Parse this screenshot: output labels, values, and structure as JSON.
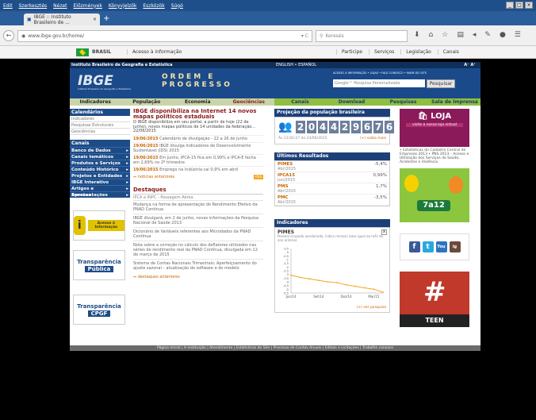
{
  "browser": {
    "menu": [
      "Edit",
      "Szerkesztés",
      "Nézet",
      "Előzmények",
      "Könyvjelzők",
      "Eszközök",
      "Súgó"
    ],
    "tab_title": "IBGE :: Instituto Brasileiro de ...",
    "url": "www.ibge.gov.br/home/",
    "search_placeholder": "Keresés",
    "win_buttons": [
      "_",
      "□",
      "×"
    ]
  },
  "govbar": {
    "country": "BRASIL",
    "access": "Acesso à informação",
    "links": [
      "Participe",
      "Serviços",
      "Legislação",
      "Canais"
    ]
  },
  "header": {
    "institute": "Instituto Brasileiro de Geografia e Estatística",
    "lang": "ENGLISH • ESPAÑOL",
    "aa": "A⁻  A⁺",
    "logo": "IBGE",
    "logo_sub": "Instituto Brasileiro de Geografia e Estatística",
    "motto": "ORDEM E PROGRESSO",
    "quicklinks": "ACESSO À INFORMAÇÃO • LOJAS • FALE CONOSCO • MAPA DO SITE",
    "search_placeholder": "Google™ Pesquisa Personalizada",
    "search_button": "Pesquisar"
  },
  "menu1": [
    "Indicadores",
    "População",
    "Economia",
    "Geociências"
  ],
  "menu2": [
    "Canais",
    "Download",
    "Pesquisas",
    "Sala de Imprensa"
  ],
  "calendar": {
    "title": "Calendários",
    "items": [
      "Indicadores",
      "Pesquisas Estruturais",
      "Geociências"
    ]
  },
  "canais": {
    "title": "Canais",
    "items": [
      "Banco de Dados",
      "Canais temáticos",
      "Produtos e Serviços",
      "Conteúdo Histórico",
      "Projetos e Entidades",
      "IBGE Interativo",
      "Artigos e Apresentações",
      "Eventos"
    ]
  },
  "side": {
    "acesso": "Acesso à Informação",
    "transp1_a": "Transparência",
    "transp1_b": "Pública",
    "transp2_a": "Transparência",
    "transp2_b": "CPGF"
  },
  "news": {
    "headline": "IBGE disponibiliza na Internet 14 novos mapas políticos estaduais",
    "headline_text": "O IBGE disponibiliza em seu portal, a partir de hoje (22 de junho), novos mapas políticos de 14 unidades da federação... 22/06/2015",
    "items": [
      {
        "date": "19/06/2015",
        "text": "Calendário de divulgação - 22 a 26 de junho"
      },
      {
        "date": "19/06/2015",
        "text": "IBGE divulga Indicadores de Desenvolvimento Sustentável (IDS) 2015"
      },
      {
        "date": "19/06/2015",
        "text": "Em junho, IPCA-15 fica em 0,99% e IPCA-E fecha em 2,69% no 2º trimestre"
      },
      {
        "date": "19/06/2015",
        "text": "Emprego na Indústria cai 0,9% em abril"
      }
    ],
    "more": "notícias anteriores",
    "rss": "RSS"
  },
  "destaques": {
    "title": "Destaques",
    "sub": "IPCA e INPC - Passagem Aérea",
    "items": [
      "Mudança na forma de apresentação do Rendimento Efetivo da PNAD Contínua",
      "IBGE divulgará, em 2 de junho, novas informações da Pesquisa Nacional de Saúde 2013",
      "Dicionário de Variáveis referentes aos Microdados da PNAD Contínua",
      "Nota sobre a correção no cálculo dos deflatores utilizados nas séries de rendimento real da PNAD Contínua, divulgada em 12 de março de 2015",
      "Sistema de Contas Nacionais Trimestrais: Aperfeiçoamento do ajuste sazonal – atualização do software e do modelo"
    ],
    "more": "destaques anteriores"
  },
  "population": {
    "title": "Projeção da população brasileira",
    "digits": [
      "2",
      "0",
      "4",
      "4",
      "2",
      "9",
      "6",
      "7",
      "6"
    ],
    "timestamp": "Às 13:02:27 de 23/06/2015",
    "more": "(+) saiba mais"
  },
  "results": {
    "title": "Últimos Resultados",
    "rows": [
      {
        "name": "PIMES",
        "period": "Abr/2015",
        "value": "-5,4%"
      },
      {
        "name": "IPCA15",
        "period": "Jun/2015",
        "value": "0,99%"
      },
      {
        "name": "PMS",
        "period": "Abr/2015",
        "value": "1,7%"
      },
      {
        "name": "PMC",
        "period": "Abr/2015",
        "value": "-3,5%"
      }
    ]
  },
  "indicators": {
    "title": "Indicadores",
    "series": "PIMES",
    "sub": "Pessoal ocupado assalariado, índice mensal, base igual ao mês do ano anterior.",
    "yticks": [
      "0,5",
      "0",
      "-0,5",
      "-1",
      "-1,5",
      "-2",
      "-2,5",
      "-3",
      "-3,5",
      "-4",
      "-4,5",
      "-5",
      "-5,5"
    ],
    "xticks": [
      "Jun/14",
      "Set/14",
      "Dez/14",
      "Mar/15"
    ],
    "more": "(+) ver pesquisa",
    "close": "x"
  },
  "chart_data": {
    "type": "line",
    "x": [
      "Jun/14",
      "Jul/14",
      "Ago/14",
      "Set/14",
      "Out/14",
      "Nov/14",
      "Dez/14",
      "Jan/15",
      "Fev/15",
      "Mar/15",
      "Abr/15"
    ],
    "series": [
      {
        "name": "PIMES",
        "values": [
          -3.1,
          -3.4,
          -3.6,
          -3.8,
          -4.0,
          -4.1,
          -4.4,
          -4.6,
          -4.8,
          -5.0,
          -5.4
        ]
      }
    ],
    "ylim": [
      -5.5,
      0.5
    ],
    "color": "#f5a623"
  },
  "loja": {
    "title": "LOJA",
    "sub": "visite a nossa loja virtual",
    "links": "• Estatísticas do Cadastro Central de Empresas 2013 • PNS 2013 – Acesso e Utilização dos Serviços de Saúde, Acidentes e Violência"
  },
  "kids": {
    "label": "7a12"
  },
  "social": [
    "f",
    "t",
    "You",
    "ig"
  ],
  "teen": {
    "hash": "#",
    "label": "TEEN"
  },
  "footer": "Página Inicial | A Instituição | Atendimento | Estatísticas do Site | Processo de Contas Anuais | Editais e Licitações | Trabalhe conosco"
}
